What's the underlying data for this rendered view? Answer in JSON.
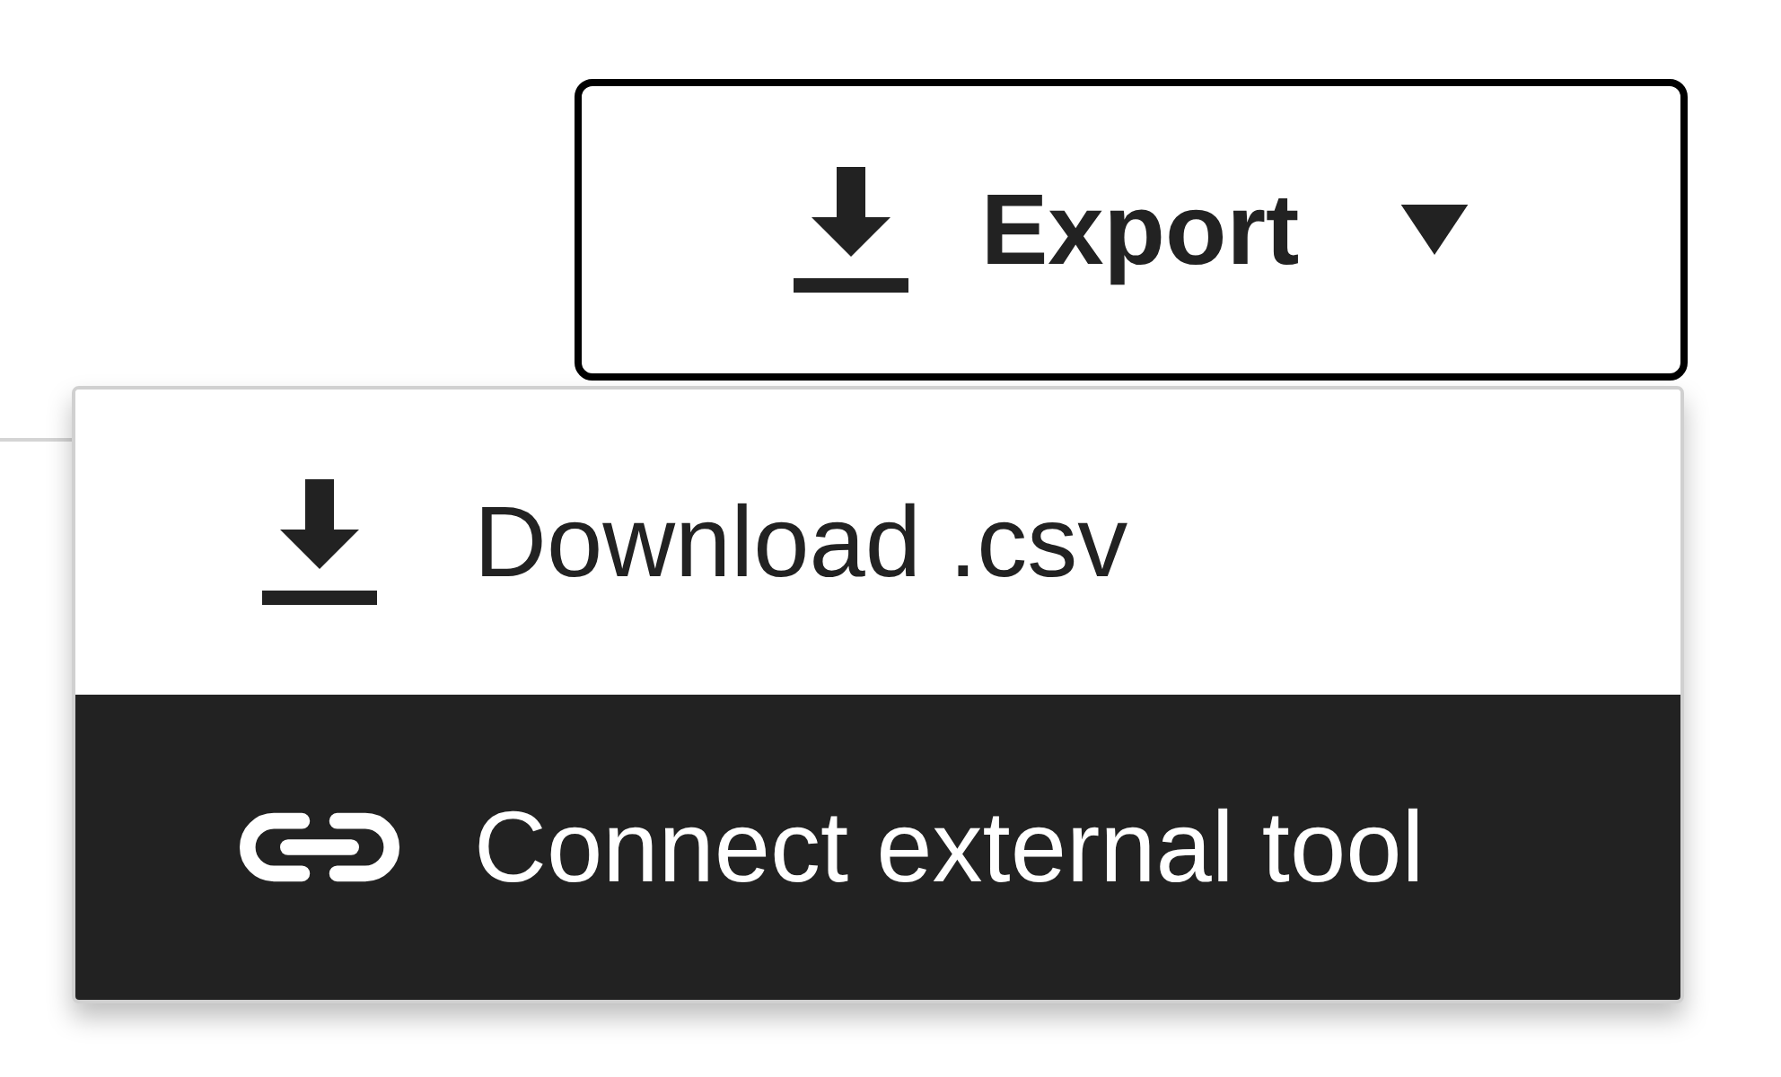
{
  "export_button": {
    "label": "Export",
    "expanded": true
  },
  "menu": {
    "items": [
      {
        "kind": "download",
        "label": "Download .csv",
        "selected": false
      },
      {
        "kind": "link",
        "label": "Connect external tool",
        "selected": true
      }
    ]
  }
}
